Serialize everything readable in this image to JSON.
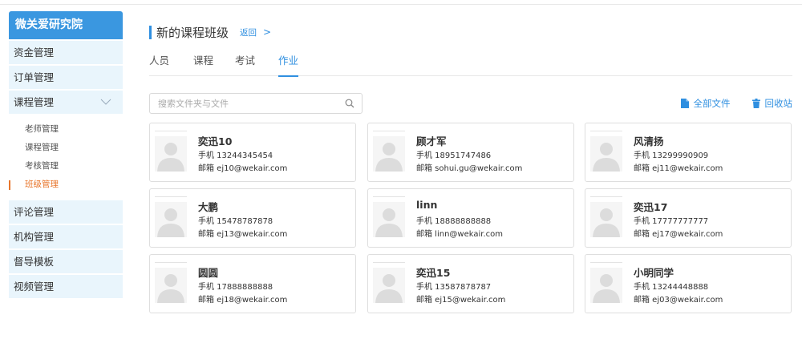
{
  "sidebar": {
    "brand": "微关爱研究院",
    "items": [
      {
        "label": "资金管理"
      },
      {
        "label": "订单管理"
      },
      {
        "label": "课程管理"
      }
    ],
    "subitems": [
      {
        "label": "老师管理"
      },
      {
        "label": "课程管理"
      },
      {
        "label": "考核管理"
      },
      {
        "label": "班级管理"
      }
    ],
    "items_after": [
      {
        "label": "评论管理"
      },
      {
        "label": "机构管理"
      },
      {
        "label": "督导模板"
      },
      {
        "label": "视频管理"
      }
    ]
  },
  "header": {
    "title": "新的课程班级",
    "back_label": "返回",
    "back_chevron": ">"
  },
  "tabs": [
    {
      "label": "人员"
    },
    {
      "label": "课程"
    },
    {
      "label": "考试"
    },
    {
      "label": "作业"
    }
  ],
  "search": {
    "placeholder": "搜索文件夹与文件"
  },
  "actions": {
    "all_files": "全部文件",
    "recycle_bin": "回收站"
  },
  "colors": {
    "brand": "#3a97e0",
    "accent": "#2f8fe0",
    "active_sub": "#e8762c",
    "menu_bg": "#e9f5fc"
  },
  "members": [
    {
      "name": "奕迅10",
      "phone": "手机 13244345454",
      "email": "邮箱 ej10@wekair.com"
    },
    {
      "name": "顾才军",
      "phone": "手机 18951747486",
      "email": "邮箱 sohui.gu@wekair.com"
    },
    {
      "name": "风清扬",
      "phone": "手机 13299990909",
      "email": "邮箱 ej11@wekair.com"
    },
    {
      "name": "大鹏",
      "phone": "手机 15478787878",
      "email": "邮箱 ej13@wekair.com"
    },
    {
      "name": "linn",
      "phone": "手机 18888888888",
      "email": "邮箱 linn@wekair.com"
    },
    {
      "name": "奕迅17",
      "phone": "手机 17777777777",
      "email": "邮箱 ej17@wekair.com"
    },
    {
      "name": "圆圆",
      "phone": "手机 17888888888",
      "email": "邮箱 ej18@wekair.com"
    },
    {
      "name": "奕迅15",
      "phone": "手机 13587878787",
      "email": "邮箱 ej15@wekair.com"
    },
    {
      "name": "小明同学",
      "phone": "手机 13244448888",
      "email": "邮箱 ej03@wekair.com"
    }
  ]
}
